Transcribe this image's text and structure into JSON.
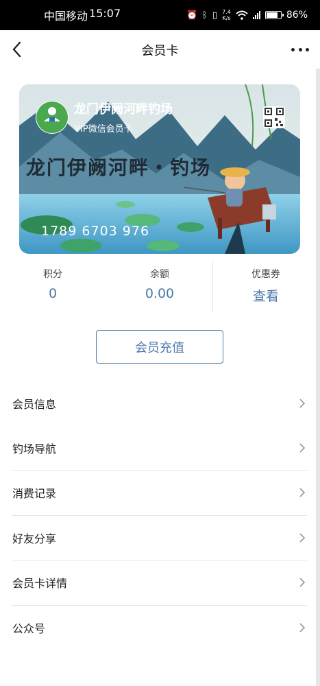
{
  "status_bar": {
    "carrier": "中国移动",
    "time": "15:07",
    "net_speed_value": "7.4",
    "net_speed_unit": "K/s",
    "battery": "86%",
    "battery_level": 0.86
  },
  "nav": {
    "title": "会员卡"
  },
  "card": {
    "logo_text": "伊阙河畔钓场",
    "name": "龙门伊阙河畔钓场",
    "subtitle": "VIP微信会员卡",
    "calligraphy": "龙门伊阙河畔・钓场",
    "number": "1789 6703 976"
  },
  "stats": {
    "points_label": "积分",
    "points_value": "0",
    "balance_label": "余额",
    "balance_value": "0.00",
    "coupon_label": "优惠券",
    "coupon_action": "查看"
  },
  "recharge_button": "会员充值",
  "menu": [
    {
      "label": "会员信息"
    },
    {
      "label": "钓场导航"
    },
    {
      "label": "消费记录"
    },
    {
      "label": "好友分享"
    },
    {
      "label": "会员卡详情"
    },
    {
      "label": "公众号"
    }
  ],
  "colors": {
    "accent": "#4c78a8",
    "status_bar_bg": "#000000",
    "card_sky": "#dce7ea",
    "card_water": "#6fb6d6"
  }
}
